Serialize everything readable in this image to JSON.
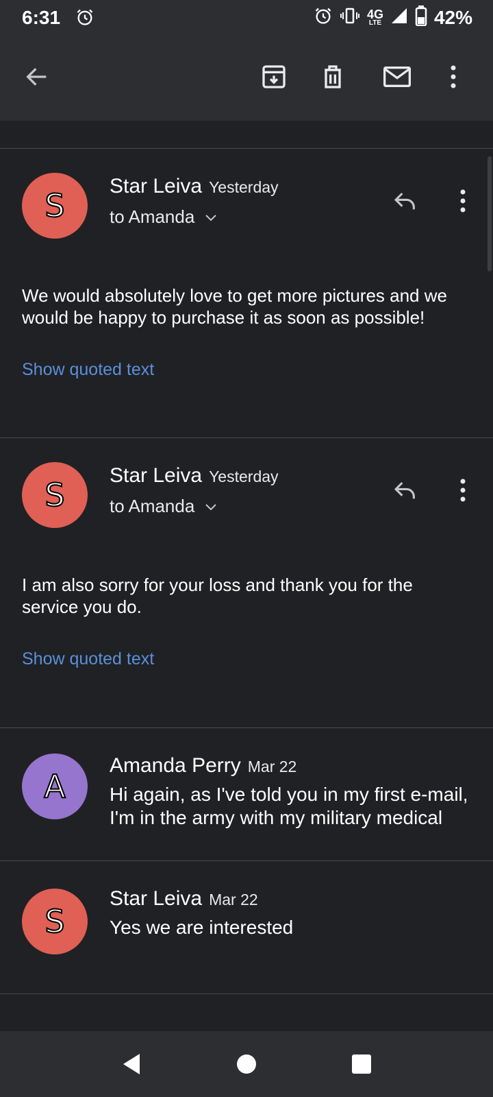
{
  "status_bar": {
    "time": "6:31",
    "network": "4G",
    "network_sub": "LTE",
    "battery": "42%"
  },
  "toolbar": {
    "icons": [
      "back-arrow-icon",
      "archive-icon",
      "delete-icon",
      "mark-unread-icon",
      "more-vert-icon"
    ]
  },
  "messages": [
    {
      "avatar_letter": "S",
      "avatar_color": "#e06055",
      "sender": "Star Leiva",
      "date": "Yesterday",
      "to": "to Amanda",
      "body": "We would absolutely love to get more pictures and we would be happy to purchase it as soon as possible!",
      "quoted_label": "Show quoted text"
    },
    {
      "avatar_letter": "S",
      "avatar_color": "#e06055",
      "sender": "Star Leiva",
      "date": "Yesterday",
      "to": "to Amanda",
      "body": "I am also sorry for your loss and thank you for the service you do.",
      "quoted_label": "Show quoted text"
    },
    {
      "avatar_letter": "A",
      "avatar_color": "#9575cd",
      "sender": "Amanda Perry",
      "date": "Mar 22",
      "snippet": "Hi again, as I've told you in my first e-mail, I'm in the army with my military medical"
    },
    {
      "avatar_letter": "S",
      "avatar_color": "#e06055",
      "sender": "Star Leiva",
      "date": "Mar 22",
      "snippet": "Yes we are interested"
    }
  ],
  "nav_bar": {
    "icons": [
      "back-triangle-icon",
      "home-circle-icon",
      "recents-square-icon"
    ]
  }
}
